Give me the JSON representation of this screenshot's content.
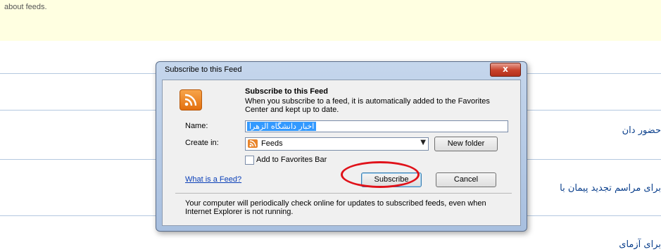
{
  "background": {
    "info_text": "about feeds.",
    "links": [
      "حضور دان",
      "برای مراسم تجدید پیمان با",
      "برای آزمای"
    ]
  },
  "dialog": {
    "title": "Subscribe to this Feed",
    "close_label": "x",
    "heading": "Subscribe to this Feed",
    "description": "When you subscribe to a feed, it is automatically added to the Favorites Center and kept up to date.",
    "name_label": "Name:",
    "name_value": "اخبار دانشگاه الزهرا",
    "create_in_label": "Create in:",
    "create_in_value": "Feeds",
    "new_folder_label": "New folder",
    "add_to_favorites_label": "Add to Favorites Bar",
    "add_to_favorites_checked": false,
    "what_is_feed_label": "What is a Feed?",
    "subscribe_label": "Subscribe",
    "cancel_label": "Cancel",
    "footer": "Your computer will periodically check online for updates to subscribed feeds, even when Internet Explorer is not running."
  },
  "colors": {
    "highlight_circle": "#e0121a",
    "info_bar": "#ffffe1",
    "rss_orange": "#e36f0e"
  }
}
